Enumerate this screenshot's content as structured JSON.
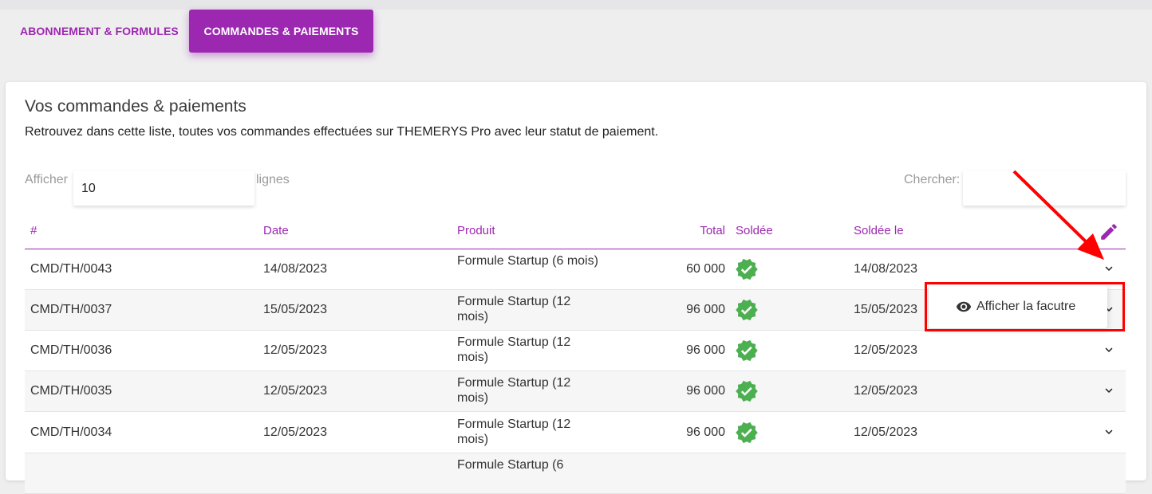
{
  "tabs": [
    {
      "label": "ABONNEMENT & FORMULES",
      "active": false
    },
    {
      "label": "COMMANDES & PAIEMENTS",
      "active": true
    }
  ],
  "card": {
    "title": "Vos commandes & paiements",
    "subtitle": "Retrouvez dans cette liste, toutes vos commandes effectuées sur THEMERYS Pro avec leur statut de paiement."
  },
  "length": {
    "label": "Afficher",
    "value": "10",
    "suffix": "lignes"
  },
  "search": {
    "label": "Chercher:",
    "value": ""
  },
  "columns": {
    "id": "#",
    "date": "Date",
    "product": "Produit",
    "total": "Total",
    "paid": "Soldée",
    "paid_on": "Soldée le"
  },
  "rows": [
    {
      "id": "CMD/TH/0043",
      "date": "14/08/2023",
      "product": "Formule Startup (6 mois)",
      "total": "60 000",
      "paid_on": "14/08/2023"
    },
    {
      "id": "CMD/TH/0037",
      "date": "15/05/2023",
      "product": "Formule Startup (12 mois)",
      "total": "96 000",
      "paid_on": "15/05/2023"
    },
    {
      "id": "CMD/TH/0036",
      "date": "12/05/2023",
      "product": "Formule Startup (12 mois)",
      "total": "96 000",
      "paid_on": "12/05/2023"
    },
    {
      "id": "CMD/TH/0035",
      "date": "12/05/2023",
      "product": "Formule Startup (12 mois)",
      "total": "96 000",
      "paid_on": "12/05/2023"
    },
    {
      "id": "CMD/TH/0034",
      "date": "12/05/2023",
      "product": "Formule Startup (12 mois)",
      "total": "96 000",
      "paid_on": "12/05/2023"
    },
    {
      "id": "",
      "date": "",
      "product": "Formule Startup (6",
      "total": "",
      "paid_on": ""
    }
  ],
  "dropdown": {
    "item_label": "Afficher la facutre",
    "icon": "eye-icon"
  },
  "colors": {
    "accent": "#9c27b0",
    "success": "#4caf50",
    "annotation": "#ff0000"
  }
}
